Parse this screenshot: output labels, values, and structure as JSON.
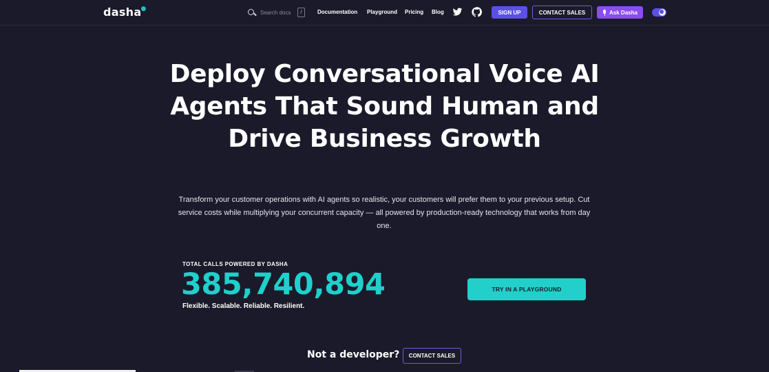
{
  "header": {
    "logo": "dasha",
    "search": {
      "placeholder": "Search docs",
      "shortcut": "/"
    },
    "nav": [
      "Documentation",
      "Playground",
      "Pricing",
      "Blog"
    ],
    "social_icons": [
      "twitter-icon",
      "github-icon"
    ],
    "signup_label": "SIGN UP",
    "contact_label": "CONTACT SALES",
    "ask_label": "Ask Dasha",
    "theme_toggle": {
      "state": "dark"
    }
  },
  "hero": {
    "title": "Deploy Conversational Voice AI Agents That Sound Human and Drive Business Growth",
    "subtitle": "Transform your customer operations with AI agents so realistic, your customers will prefer them to your previous setup. Cut service costs while multiplying your concurrent capacity — all powered by production-ready technology that works from day one."
  },
  "stats": {
    "label": "TOTAL CALLS POWERED BY DASHA",
    "value": "385,740,894",
    "tagline": "Flexible. Scalable. Reliable. Resilient.",
    "cta_label": "TRY IN A PLAYGROUND"
  },
  "footer_cta": {
    "question": "Not a developer?",
    "contact_label": "CONTACT SALES"
  },
  "colors": {
    "background": "#1b1a2a",
    "accent_teal": "#1fd0cc",
    "accent_indigo": "#5b4fe6",
    "accent_purple": "#8a4df0"
  }
}
